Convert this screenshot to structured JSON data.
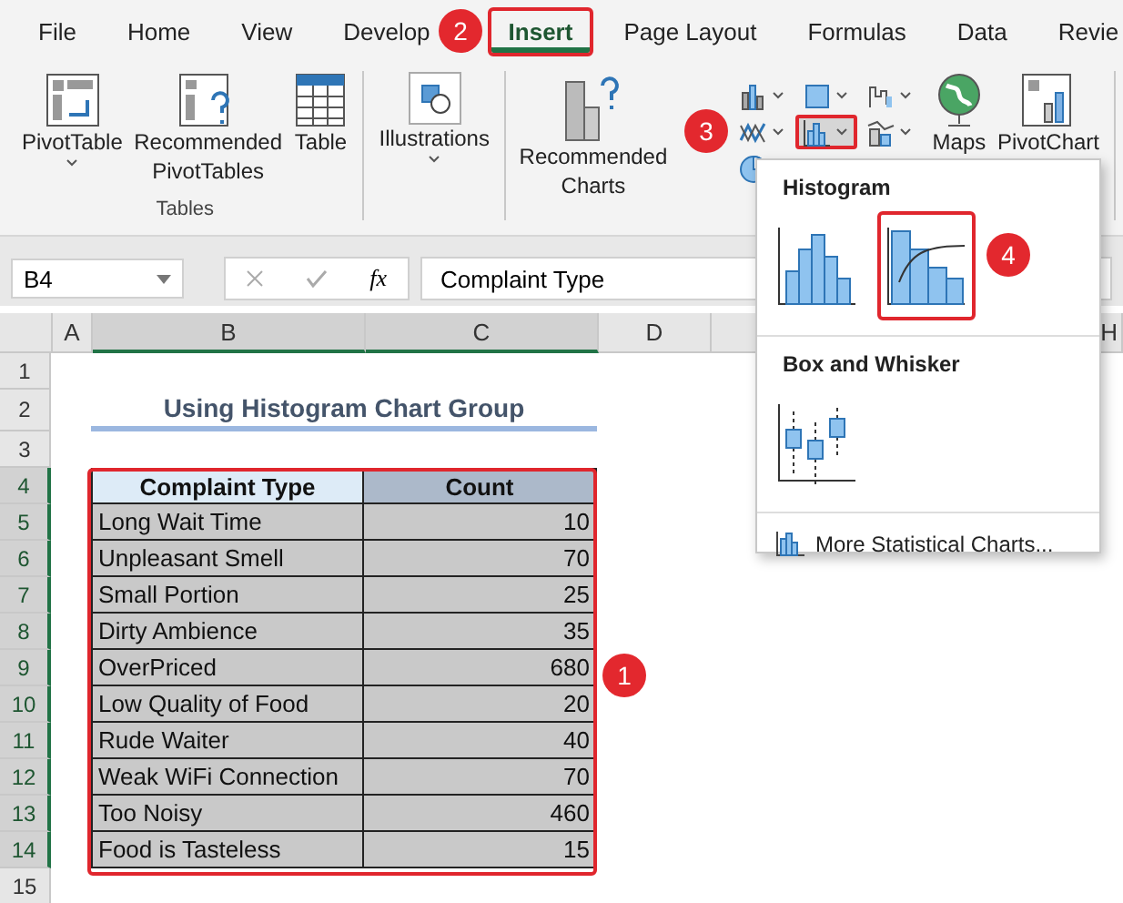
{
  "menu_tabs": [
    {
      "label": "File",
      "selected": false,
      "highlighted": false
    },
    {
      "label": "Home",
      "selected": false,
      "highlighted": false
    },
    {
      "label": "View",
      "selected": false,
      "highlighted": false
    },
    {
      "label": "Develop",
      "selected": false,
      "highlighted": false
    },
    {
      "label": "Insert",
      "selected": true,
      "highlighted": true
    },
    {
      "label": "Page Layout",
      "selected": false,
      "highlighted": false
    },
    {
      "label": "Formulas",
      "selected": false,
      "highlighted": false
    },
    {
      "label": "Data",
      "selected": false,
      "highlighted": false
    },
    {
      "label": "Revie",
      "selected": false,
      "highlighted": false
    }
  ],
  "ribbon": {
    "groups": [
      {
        "label": "Tables",
        "buttons": [
          {
            "kind": "pivot-table",
            "label": "PivotTable",
            "dropdown": true
          },
          {
            "kind": "recommended-pivot",
            "label": "Recommended PivotTables",
            "dropdown": false
          },
          {
            "kind": "table",
            "label": "Table",
            "dropdown": false
          }
        ]
      },
      {
        "buttons": [
          {
            "kind": "illustrations",
            "label": "Illustrations",
            "dropdown": true
          }
        ]
      },
      {
        "buttons": [
          {
            "kind": "recommended-charts",
            "label": "Recommended Charts",
            "dropdown": false
          }
        ],
        "chart_buttons": [
          {
            "kind": "column",
            "selected": false,
            "highlighted": false
          },
          {
            "kind": "hierarchy",
            "selected": false,
            "highlighted": false
          },
          {
            "kind": "waterfall",
            "selected": false,
            "highlighted": false
          },
          {
            "kind": "line",
            "selected": false,
            "highlighted": false
          },
          {
            "kind": "statistic",
            "selected": true,
            "highlighted": true
          },
          {
            "kind": "combo",
            "selected": false,
            "highlighted": false
          },
          {
            "kind": "pie",
            "selected": false,
            "highlighted": false
          }
        ],
        "more_buttons": [
          {
            "kind": "maps",
            "label": "Maps"
          },
          {
            "kind": "pivot-chart",
            "label": "PivotChart"
          }
        ]
      }
    ]
  },
  "formula_bar": {
    "name_box": "B4",
    "function_label": "fx",
    "formula": "Complaint Type"
  },
  "sheet": {
    "columns": [
      {
        "label": "A",
        "selected": false
      },
      {
        "label": "B",
        "selected": true
      },
      {
        "label": "C",
        "selected": true
      },
      {
        "label": "D",
        "selected": false
      },
      {
        "label": "H",
        "selected": false
      }
    ],
    "rows": [
      {
        "label": "1",
        "selected": false
      },
      {
        "label": "2",
        "selected": false
      },
      {
        "label": "3",
        "selected": false
      },
      {
        "label": "4",
        "selected": true
      },
      {
        "label": "5",
        "selected": true
      },
      {
        "label": "6",
        "selected": true
      },
      {
        "label": "7",
        "selected": true
      },
      {
        "label": "8",
        "selected": true
      },
      {
        "label": "9",
        "selected": true
      },
      {
        "label": "10",
        "selected": true
      },
      {
        "label": "11",
        "selected": true
      },
      {
        "label": "12",
        "selected": true
      },
      {
        "label": "13",
        "selected": true
      },
      {
        "label": "14",
        "selected": true
      },
      {
        "label": "15",
        "selected": false
      }
    ],
    "title": "Using Histogram Chart Group",
    "table": {
      "columns": [
        "Complaint Type",
        "Count"
      ],
      "rows": [
        [
          "Long Wait Time",
          "10"
        ],
        [
          "Unpleasant Smell",
          "70"
        ],
        [
          "Small Portion",
          "25"
        ],
        [
          "Dirty Ambience",
          "35"
        ],
        [
          "OverPriced",
          "680"
        ],
        [
          "Low Quality of Food",
          "20"
        ],
        [
          "Rude Waiter",
          "40"
        ],
        [
          "Weak WiFi Connection",
          "70"
        ],
        [
          "Too Noisy",
          "460"
        ],
        [
          "Food is Tasteless",
          "15"
        ]
      ]
    }
  },
  "dropdown": {
    "sections": [
      {
        "title": "Histogram",
        "options": [
          {
            "kind": "histogram",
            "highlighted": false
          },
          {
            "kind": "pareto",
            "highlighted": true
          }
        ]
      },
      {
        "title": "Box and Whisker",
        "options": [
          {
            "kind": "box-whisker",
            "highlighted": false
          }
        ]
      }
    ],
    "footer": "More Statistical Charts..."
  },
  "badges": [
    {
      "label": "1"
    },
    {
      "label": "2"
    },
    {
      "label": "3"
    },
    {
      "label": "4"
    }
  ]
}
